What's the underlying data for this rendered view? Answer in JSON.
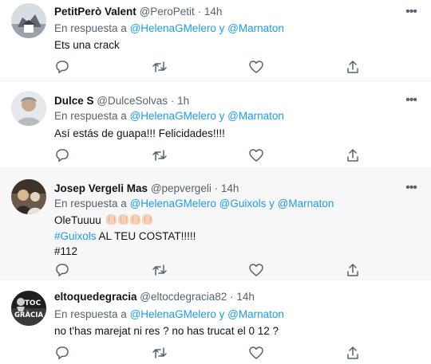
{
  "tweets": [
    {
      "name": "PetitPerò Valent",
      "handle": "@PeroPetit",
      "dot": "·",
      "time": "14h",
      "reply_prefix": "En respuesta a",
      "reply_mentions": [
        "@HelenaGMelero",
        "@Marnaton"
      ],
      "reply_joiner": "y",
      "text_lines": [
        "Ets una crack"
      ]
    },
    {
      "name": "Dulce S",
      "handle": "@DulceSolvas",
      "dot": "·",
      "time": "1h",
      "reply_prefix": "En respuesta a",
      "reply_mentions": [
        "@HelenaGMelero",
        "@Marnaton"
      ],
      "reply_joiner": "y",
      "text_lines": [
        "Así estás de guapa!!! Felicidades!!!!"
      ]
    },
    {
      "name": "Josep Vergeli Mas",
      "handle": "@pepvergeli",
      "dot": "·",
      "time": "14h",
      "reply_prefix": "En respuesta a",
      "reply_mentions": [
        "@HelenaGMelero",
        "@Guixols",
        "@Marnaton"
      ],
      "reply_joiner": "y",
      "text_line1": "OleTuuuu",
      "hashtag": "#Guixols",
      "text_line2_rest": "AL TEU COSTAT!!!!!",
      "text_line3": "#112"
    },
    {
      "name": "eltoquedegracia",
      "handle": "@eltocdegracia82",
      "dot": "·",
      "time": "14h",
      "reply_prefix": "En respuesta a",
      "reply_mentions": [
        "@HelenaGMelero",
        "@Marnaton"
      ],
      "reply_joiner": "y",
      "text_lines": [
        "no t'has marejat ni res ? no has trucat el 0 12 ?"
      ],
      "avatar_text": [
        "TOC",
        "GRÀCIA"
      ]
    }
  ],
  "more_glyph": "•••",
  "actions": [
    "reply-icon",
    "retweet-icon",
    "like-icon",
    "share-icon"
  ],
  "colors": {
    "link": "#1d9bf0",
    "secondary": "#536471",
    "primary": "#0f1419",
    "highlight_bg": "#f7f7f7"
  }
}
